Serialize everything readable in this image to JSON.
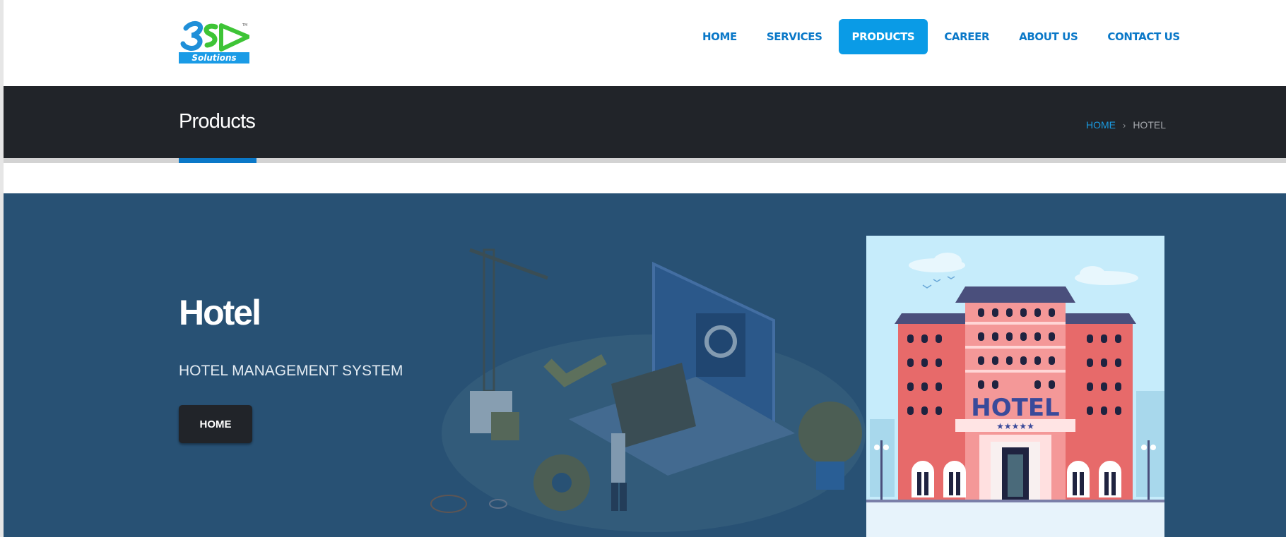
{
  "logo": {
    "icon": "3sd-solutions-logo",
    "text": "Solutions"
  },
  "nav": {
    "items": [
      {
        "label": "HOME",
        "active": false
      },
      {
        "label": "SERVICES",
        "active": false
      },
      {
        "label": "PRODUCTS",
        "active": true
      },
      {
        "label": "CAREER",
        "active": false
      },
      {
        "label": "ABOUT US",
        "active": false
      },
      {
        "label": "CONTACT US",
        "active": false
      }
    ]
  },
  "titlebar": {
    "title": "Products",
    "breadcrumb": {
      "home": "HOME",
      "separator": "›",
      "current": "HOTEL"
    }
  },
  "hero": {
    "title": "Hotel",
    "subtitle": "HOTEL MANAGEMENT SYSTEM",
    "button_label": "HOME",
    "illustration_icon": "developer-illustration",
    "image": {
      "icon": "hotel-building-image",
      "sign_text": "HOTEL",
      "stars": "★★★★★"
    }
  },
  "colors": {
    "accent": "#0a9be6",
    "nav_text": "#0a78c8",
    "titlebar_bg": "#212429",
    "hero_bg": "#285174"
  }
}
